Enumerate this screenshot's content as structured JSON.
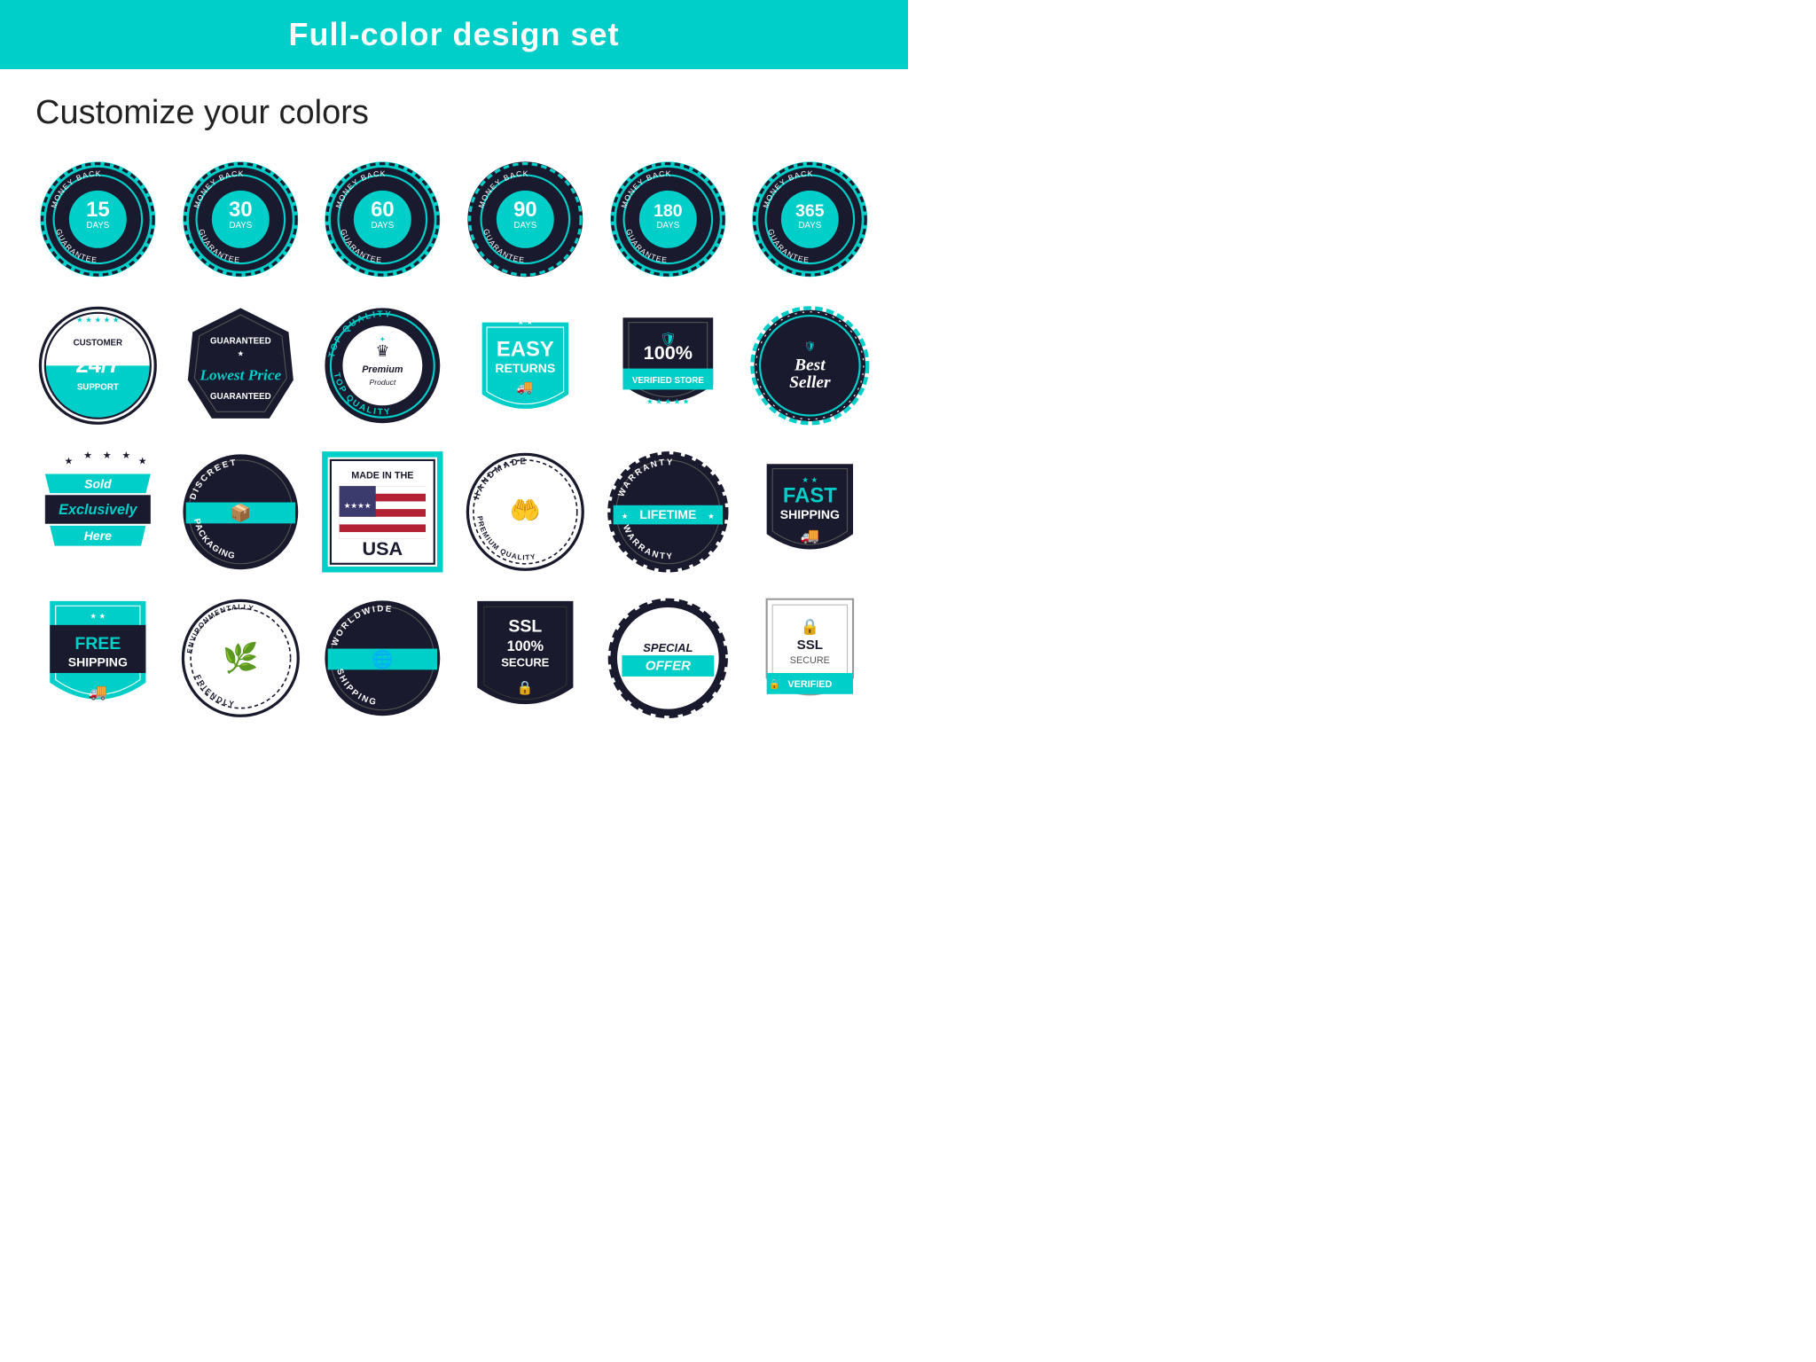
{
  "header": {
    "title": "Full-color design set"
  },
  "subtitle": "Customize your colors",
  "badges": {
    "row1": [
      {
        "label": "MONEY BACK GUARANTEE",
        "days": "15",
        "unit": "DAYS"
      },
      {
        "label": "MONEY BACK GUARANTEE",
        "days": "30",
        "unit": "DAYS"
      },
      {
        "label": "MONEY BACK GUARANTEE",
        "days": "60",
        "unit": "DAYS"
      },
      {
        "label": "MONEY BACK GUARANTEE",
        "days": "90",
        "unit": "DAYS"
      },
      {
        "label": "MONEY BACK GUARANTEE",
        "days": "180",
        "unit": "DAYS"
      },
      {
        "label": "MONEY BACK GUARANTEE",
        "days": "365",
        "unit": "DAYS"
      }
    ],
    "row2": [
      {
        "type": "customer-support",
        "line1": "CUSTOMER",
        "line2": "24/7",
        "line3": "SUPPORT"
      },
      {
        "type": "lowest-price",
        "line1": "GUARANTEED",
        "line2": "Lowest Price",
        "line3": "GUARANTEED"
      },
      {
        "type": "top-quality",
        "line1": "TOP QUALITY",
        "line2": "Premium Product"
      },
      {
        "type": "easy-returns",
        "line1": "EASY",
        "line2": "RETURNS"
      },
      {
        "type": "verified-store",
        "line1": "100%",
        "line2": "VERIFIED STORE"
      },
      {
        "type": "best-seller",
        "line1": "Best",
        "line2": "Seller"
      }
    ],
    "row3": [
      {
        "type": "sold-exclusively",
        "line1": "Sold",
        "line2": "Exclusively",
        "line3": "Here"
      },
      {
        "type": "discreet-packaging",
        "line1": "DISCREET",
        "line2": "PACKAGING"
      },
      {
        "type": "made-in-usa",
        "line1": "MADE IN THE",
        "line2": "USA"
      },
      {
        "type": "handmade",
        "line1": "HANDMADE",
        "line2": "PREMIUM QUALITY"
      },
      {
        "type": "lifetime-warranty",
        "line1": "WARRANTY",
        "line2": "LIFETIME",
        "line3": "WARRANTY"
      },
      {
        "type": "fast-shipping",
        "line1": "FAST",
        "line2": "SHIPPING"
      }
    ],
    "row4": [
      {
        "type": "free-shipping",
        "line1": "FREE",
        "line2": "SHIPPING"
      },
      {
        "type": "eco-friendly",
        "line1": "ENVIRONMENTALLY",
        "line2": "FRIENDLY"
      },
      {
        "type": "worldwide-shipping",
        "line1": "WORLDWIDE",
        "line2": "SHIPPING"
      },
      {
        "type": "ssl-secure",
        "line1": "SSL",
        "line2": "100%",
        "line3": "SECURE"
      },
      {
        "type": "special-offer",
        "line1": "SPECIAL",
        "line2": "OFFER"
      },
      {
        "type": "ssl-verified",
        "line1": "SSL",
        "line2": "SECURE",
        "line3": "VERIFIED"
      }
    ]
  },
  "colors": {
    "teal": "#00CEC9",
    "dark": "#1a1a2e",
    "black": "#111",
    "white": "#ffffff"
  }
}
